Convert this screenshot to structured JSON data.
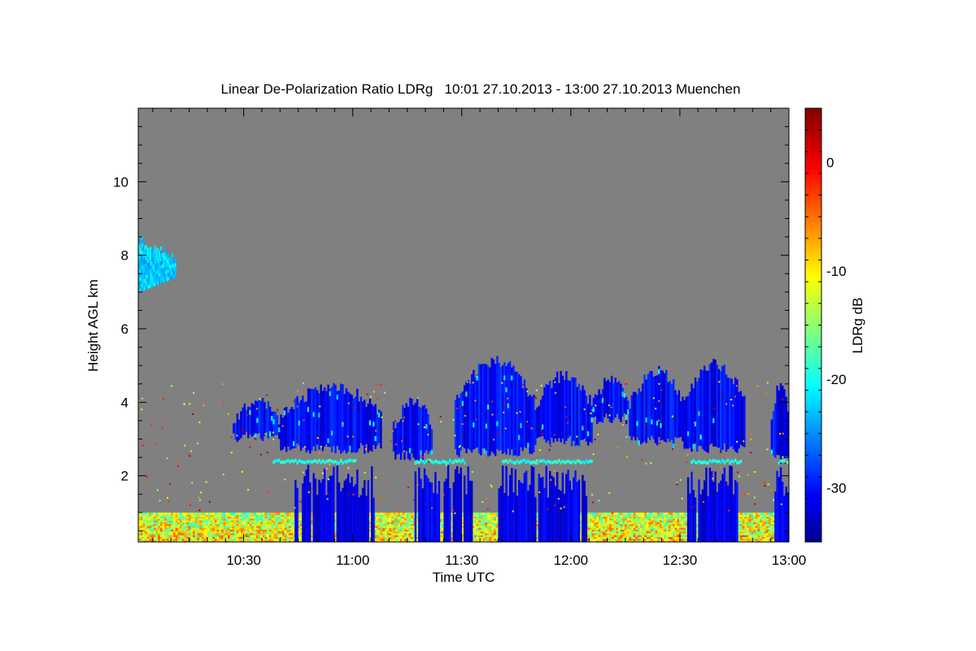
{
  "chart_data": {
    "type": "heatmap",
    "title": "Linear De-Polarization Ratio LDRg   10:01 27.10.2013 - 13:00 27.10.2013 Muenchen",
    "xlabel": "Time UTC",
    "ylabel": "Height AGL km",
    "colorbar_label": "LDRg dB",
    "x_range_utc": [
      "10:01",
      "13:00"
    ],
    "x_ticks": [
      "10:30",
      "11:00",
      "11:30",
      "12:00",
      "12:30",
      "13:00"
    ],
    "y_range_km": [
      0.2,
      12.0
    ],
    "y_ticks": [
      2,
      4,
      6,
      8,
      10
    ],
    "color_range_db": [
      -35,
      5
    ],
    "colorbar_ticks": [
      0,
      -10,
      -20,
      -30
    ],
    "colormap": "jet",
    "colors": {
      "background": "#808080",
      "low": "#0000ff",
      "mid": "#00ffff",
      "high": "#ffff00",
      "max": "#800000"
    },
    "layers": [
      {
        "name": "cirrus",
        "start": "10:01",
        "end": "10:11",
        "base_km": 7.0,
        "top_km": 8.5,
        "ldr_db": -22
      },
      {
        "name": "mid-level cloud",
        "start": "10:27",
        "end": "12:59",
        "base_km": 2.3,
        "top_km": 5.3,
        "ldr_db": -30
      },
      {
        "name": "melting layer",
        "start": "10:38",
        "end": "12:59",
        "height_km": 2.35,
        "ldr_db": -19
      },
      {
        "name": "precipitation",
        "start": "10:41",
        "end": "12:46",
        "base_km": 0.2,
        "top_km": 2.3,
        "ldr_db": -31
      },
      {
        "name": "boundary layer",
        "start": "10:01",
        "end": "13:00",
        "base_km": 0.2,
        "top_km": 1.0,
        "ldr_db": -10
      }
    ]
  }
}
